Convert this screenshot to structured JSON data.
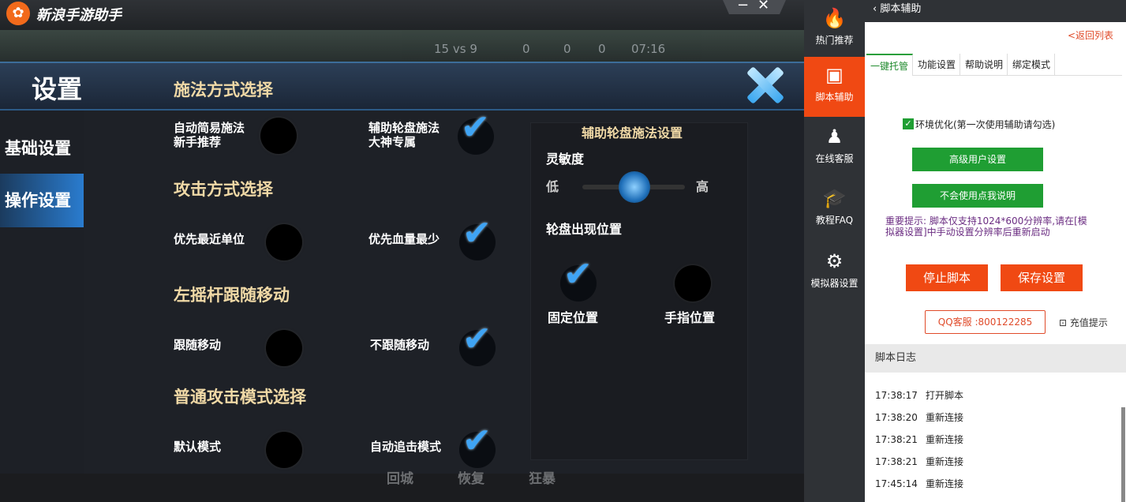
{
  "app": {
    "title": "新浪手游助手",
    "logo": "✿",
    "min": "−",
    "close": "✕"
  },
  "hud": {
    "score": "15 vs 9",
    "k1": "0",
    "k2": "0",
    "k3": "0",
    "time": "07:16"
  },
  "settings": {
    "title": "设置",
    "nav": [
      "基础设置",
      "操作设置"
    ],
    "sections": [
      "施法方式选择",
      "攻击方式选择",
      "左摇杆跟随移动",
      "普通攻击模式选择"
    ],
    "options": [
      {
        "a": "自动简易施法\n新手推荐",
        "a1": "自动简易施法",
        "a2": "新手推荐",
        "b1": "辅助轮盘施法",
        "b2": "大神专属"
      },
      {
        "a": "优先最近单位",
        "b": "优先血量最少"
      },
      {
        "a": "跟随移动",
        "b": "不跟随移动"
      },
      {
        "a": "默认模式",
        "b": "自动追击模式"
      }
    ],
    "panel": {
      "title": "辅助轮盘施法设置",
      "sens": "灵敏度",
      "low": "低",
      "high": "高",
      "sens_value": 0.5,
      "pos_title": "轮盘出现位置",
      "fixed": "固定位置",
      "finger": "手指位置"
    },
    "check": "✔",
    "bottom": [
      "回城",
      "恢复",
      "狂暴"
    ]
  },
  "sidebar": [
    {
      "label": "热门推荐",
      "icon": "flame-icon",
      "glyph": "🔥"
    },
    {
      "label": "脚本辅助",
      "icon": "terminal-icon",
      "glyph": "▣"
    },
    {
      "label": "在线客服",
      "icon": "qq-icon",
      "glyph": "♟"
    },
    {
      "label": "教程FAQ",
      "icon": "graduation-cap-icon",
      "glyph": "🎓"
    },
    {
      "label": "模拟器设置",
      "icon": "gear-icon",
      "glyph": "⚙"
    }
  ],
  "panel": {
    "header": "脚本辅助",
    "back": "<返回列表",
    "tabs": [
      "一键托管",
      "功能设置",
      "帮助说明",
      "绑定模式"
    ],
    "checkbox": "环境优化(第一次使用辅助请勾选)",
    "btn_adv": "高级用户设置",
    "btn_help": "不会使用点我说明",
    "notice": "重要提示: 脚本仅支持1024*600分辨率,请在[模拟器设置]中手动设置分辨率后重新启动",
    "stop": "停止脚本",
    "save": "保存设置",
    "qq": "QQ客服 :800122285",
    "recharge": "充值提示",
    "log_title": "脚本日志",
    "logs": [
      {
        "t": "17:38:17",
        "m": "打开脚本"
      },
      {
        "t": "17:38:20",
        "m": "重新连接"
      },
      {
        "t": "17:38:21",
        "m": "重新连接"
      },
      {
        "t": "17:38:21",
        "m": "重新连接"
      },
      {
        "t": "17:45:14",
        "m": "重新连接"
      }
    ]
  }
}
